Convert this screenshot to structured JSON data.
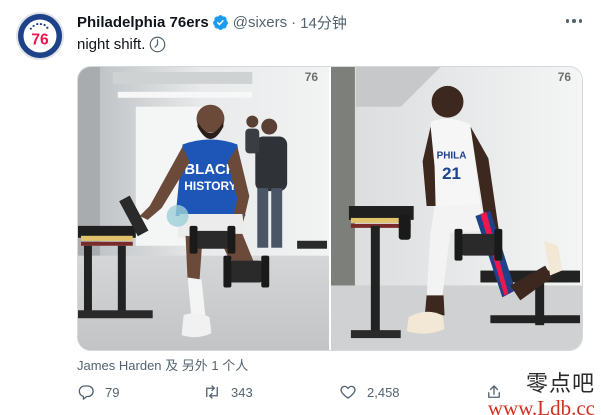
{
  "tweet": {
    "author_name": "Philadelphia 76ers",
    "handle": "@sixers",
    "separator": "·",
    "time": "14分钟",
    "text": "night shift.",
    "tagged_people": "James Harden 及 另外 1 个人",
    "avatar_logo_text": "76",
    "verified_icon": "verified-badge-icon",
    "text_icon": "clock-icon"
  },
  "media": {
    "left_photo": {
      "corner_logo": "76",
      "shirt_line1": "BLACK",
      "shirt_line2": "HISTORY"
    },
    "right_photo": {
      "corner_logo": "76",
      "jersey_team": "PHILA",
      "jersey_number": "21"
    }
  },
  "actions": {
    "reply_count": "79",
    "retweet_count": "343",
    "like_count": "2,458",
    "share_icon": "share-icon"
  },
  "watermark": {
    "top": "零点吧",
    "bottom": "www.Ldb.cc"
  },
  "colors": {
    "brand_blue": "#1d428a",
    "brand_red": "#ed174c",
    "verified_blue": "#1d9bf0",
    "muted_text": "#536471"
  }
}
